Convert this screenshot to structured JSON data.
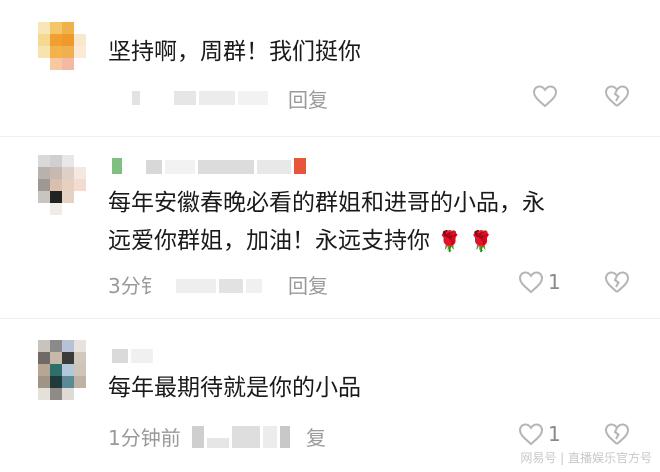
{
  "comments": [
    {
      "text_lines": [
        "坚持啊，周群！我们挺你"
      ],
      "reply_label": "回复",
      "like_count": ""
    },
    {
      "text_lines": [
        "每年安徽春晚必看的群姐和进哥的小品，永",
        "远爱你群姐，加油！永远支持你"
      ],
      "emoji": "🌹 🌹",
      "time_prefix": "3分钅",
      "reply_label": "回复",
      "like_count": "1"
    },
    {
      "text_lines": [
        "每年最期待就是你的小品"
      ],
      "time_prefix": "1分钟前",
      "reply_label": "复",
      "like_count": "1"
    }
  ],
  "watermark": "网易号 | 直播娱乐官方号",
  "colors": {
    "text": "#1a1a1a",
    "meta": "#999999",
    "icon": "#b5b5b5"
  }
}
